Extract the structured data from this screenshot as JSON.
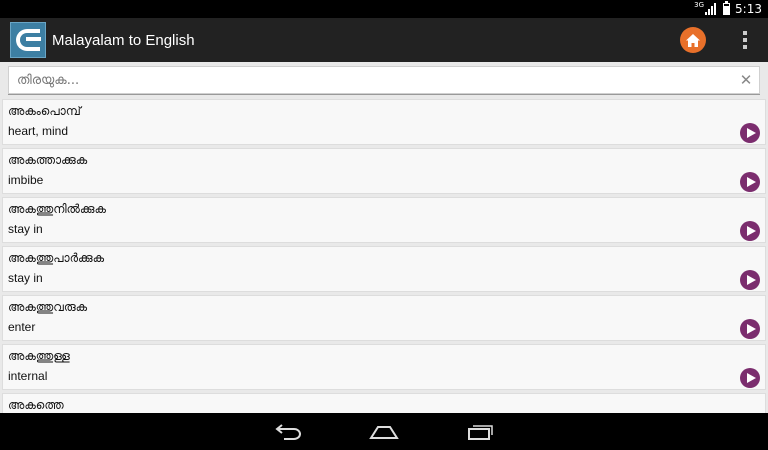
{
  "status_bar": {
    "network": "3G",
    "time": "5:13"
  },
  "action_bar": {
    "title": "Malayalam to English",
    "home_icon": "home-icon",
    "overflow_icon": "overflow-menu-icon",
    "accent": "#e8702a"
  },
  "search": {
    "placeholder": "തിരയുക...",
    "value": ""
  },
  "entries": [
    {
      "malayalam": "അകംപൊമ്പ്",
      "english": "heart, mind"
    },
    {
      "malayalam": "അകത്താക്കുക",
      "english": "imbibe"
    },
    {
      "malayalam": "അകത്തുനിൽക്കുക",
      "english": "stay in"
    },
    {
      "malayalam": "അകത്തുപാർക്കുക",
      "english": "stay in"
    },
    {
      "malayalam": "അകത്തുവരുക",
      "english": "enter"
    },
    {
      "malayalam": "അകത്തുള്ള",
      "english": "internal"
    },
    {
      "malayalam": "അകത്തെ",
      "english": ""
    }
  ],
  "colors": {
    "play_button": "#7b2d6e",
    "action_bar": "#222222"
  }
}
